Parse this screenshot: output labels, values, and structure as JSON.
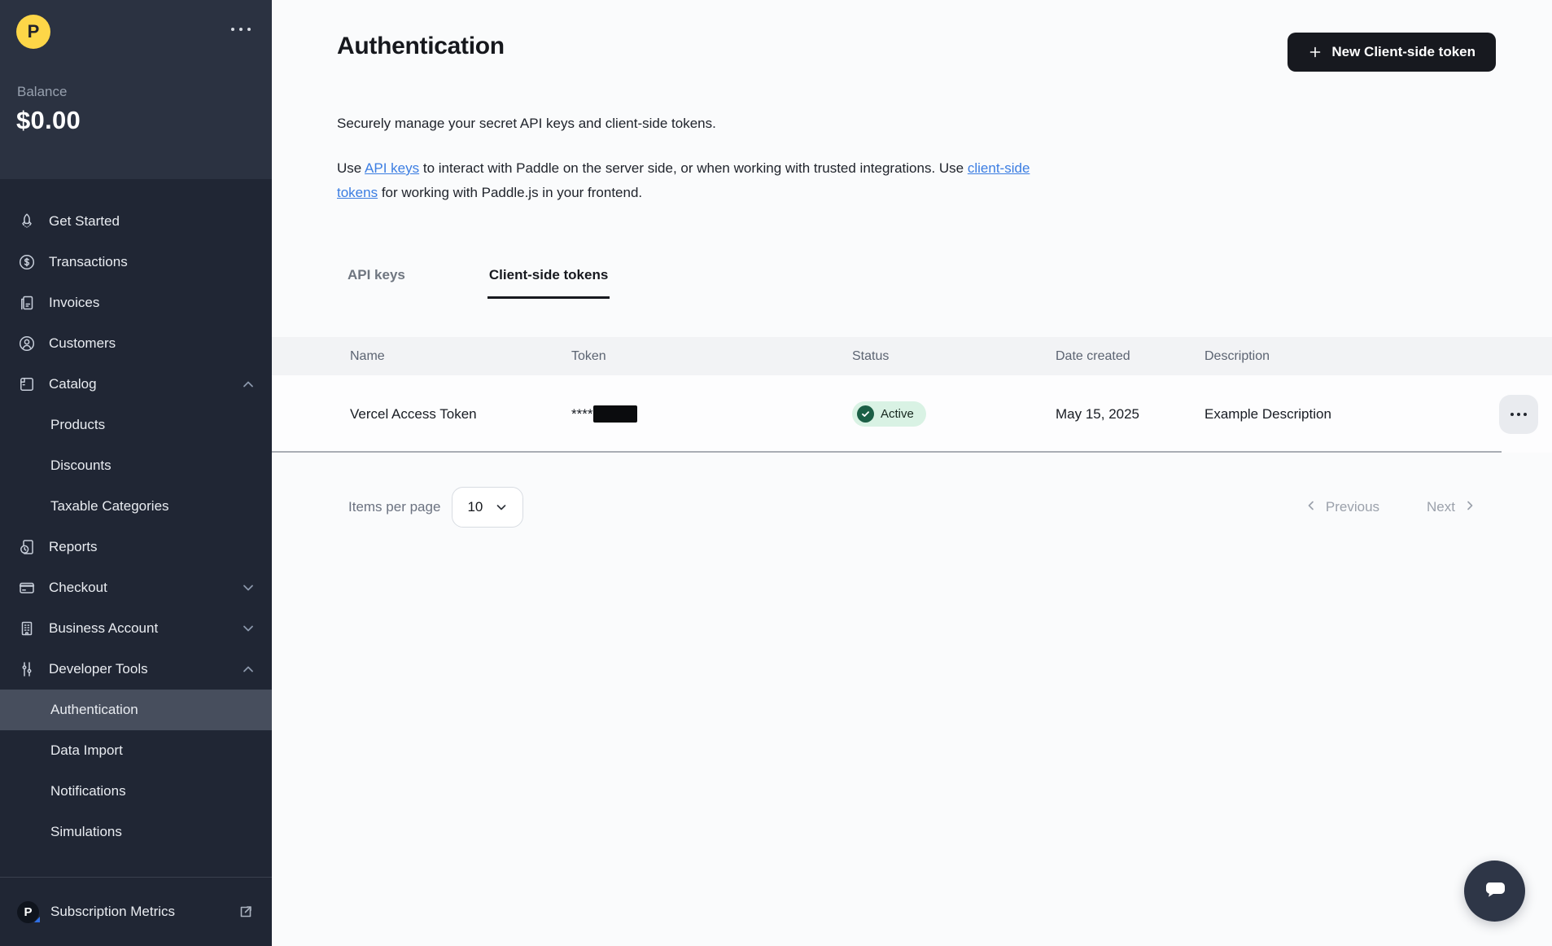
{
  "sidebar": {
    "logo_letter": "P",
    "balance_label": "Balance",
    "balance_value": "$0.00",
    "nav": [
      {
        "label": "Get Started"
      },
      {
        "label": "Transactions"
      },
      {
        "label": "Invoices"
      },
      {
        "label": "Customers"
      },
      {
        "label": "Catalog",
        "chevron": "up"
      },
      {
        "label": "Products"
      },
      {
        "label": "Discounts"
      },
      {
        "label": "Taxable Categories"
      },
      {
        "label": "Reports"
      },
      {
        "label": "Checkout",
        "chevron": "down"
      },
      {
        "label": "Business Account",
        "chevron": "down"
      },
      {
        "label": "Developer Tools",
        "chevron": "up"
      },
      {
        "label": "Authentication",
        "selected": true
      },
      {
        "label": "Data Import"
      },
      {
        "label": "Notifications"
      },
      {
        "label": "Simulations"
      }
    ],
    "footer_label": "Subscription Metrics"
  },
  "header": {
    "title": "Authentication",
    "new_token_button": "New Client-side token"
  },
  "intro": {
    "line1": "Securely manage your secret API keys and client-side tokens.",
    "p2_seg1": "Use ",
    "p2_link1": "API keys",
    "p2_seg2": " to interact with Paddle on the server side, or when working with trusted integrations. Use ",
    "p2_link2": "client-side tokens",
    "p2_seg3": " for working with Paddle.js in your frontend."
  },
  "tabs": {
    "api_keys": "API keys",
    "client_side_tokens": "Client-side tokens"
  },
  "table": {
    "columns": [
      "Name",
      "Token",
      "Status",
      "Date created",
      "Description"
    ],
    "row": {
      "name": "Vercel Access Token",
      "token_masked": "****",
      "status": "Active",
      "date_created": "May 15, 2025",
      "description": "Example Description"
    }
  },
  "pagination": {
    "items_per_page_label": "Items per page",
    "items_per_page_value": "10",
    "previous_label": "Previous",
    "next_label": "Next"
  },
  "colors": {
    "accent_yellow": "#FDD648",
    "sidebar_bg": "#202634",
    "sidebar_top_bg": "#2B3241",
    "selected_item_bg": "#474E5D",
    "button_dark": "#17191F",
    "link_blue": "#3B7DE2",
    "badge_bg": "#D9F2E4",
    "badge_check": "#1C5F46"
  }
}
